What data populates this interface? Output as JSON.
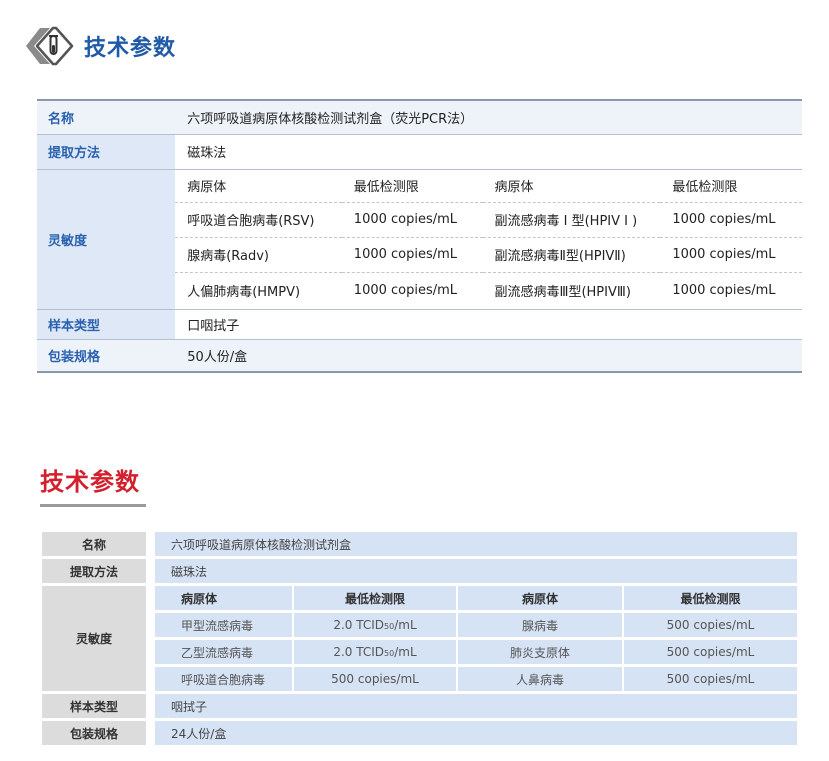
{
  "section1": {
    "title": "技术参数",
    "rows": {
      "name": {
        "label": "名称",
        "value": "六项呼吸道病原体核酸检测试剂盒（荧光PCR法）"
      },
      "extraction": {
        "label": "提取方法",
        "value": "磁珠法"
      },
      "sensitivity": {
        "label": "灵敏度",
        "headers": [
          "病原体",
          "最低检测限",
          "病原体",
          "最低检测限"
        ],
        "rows": [
          [
            "呼吸道合胞病毒(RSV)",
            "1000 copies/mL",
            "副流感病毒 I 型(HPIV I )",
            "1000 copies/mL"
          ],
          [
            "腺病毒(Radv)",
            "1000 copies/mL",
            "副流感病毒Ⅱ型(HPIVⅡ)",
            "1000 copies/mL"
          ],
          [
            "人偏肺病毒(HMPV)",
            "1000 copies/mL",
            "副流感病毒Ⅲ型(HPIVⅢ)",
            "1000 copies/mL"
          ]
        ]
      },
      "sample": {
        "label": "样本类型",
        "value": "口咽拭子"
      },
      "package": {
        "label": "包装规格",
        "value": "50人份/盒"
      }
    }
  },
  "section2": {
    "title": "技术参数",
    "rows": {
      "name": {
        "label": "名称",
        "value": "六项呼吸道病原体核酸检测试剂盒"
      },
      "extraction": {
        "label": "提取方法",
        "value": "磁珠法"
      },
      "sensitivity": {
        "label": "灵敏度",
        "headers": [
          "病原体",
          "最低检测限",
          "病原体",
          "最低检测限"
        ],
        "rows": [
          [
            {
              "t": "甲型流感病毒"
            },
            {
              "t": "2.0 TCID",
              "sub": "50",
              "after": "/mL"
            },
            {
              "t": "腺病毒"
            },
            {
              "t": "500 copies/mL"
            }
          ],
          [
            {
              "t": "乙型流感病毒"
            },
            {
              "t": "2.0 TCID",
              "sub": "50",
              "after": "/mL"
            },
            {
              "t": "肺炎支原体"
            },
            {
              "t": "500 copies/mL"
            }
          ],
          [
            {
              "t": "呼吸道合胞病毒"
            },
            {
              "t": "500 copies/mL"
            },
            {
              "t": "人鼻病毒"
            },
            {
              "t": "500 copies/mL"
            }
          ]
        ]
      },
      "sample": {
        "label": "样本类型",
        "value": "咽拭子"
      },
      "package": {
        "label": "包装规格",
        "value": "24人份/盒"
      }
    }
  },
  "colors": {
    "blue_title": "#1f5aa6",
    "red_title": "#d3202f",
    "label_blue_bg": "#dfe8f6",
    "cell_blue_bg": "#d6e3f5",
    "label_grey_bg": "#dcdcdc"
  },
  "icons": {
    "section1_icon": "test-tube-diamond-icon"
  }
}
